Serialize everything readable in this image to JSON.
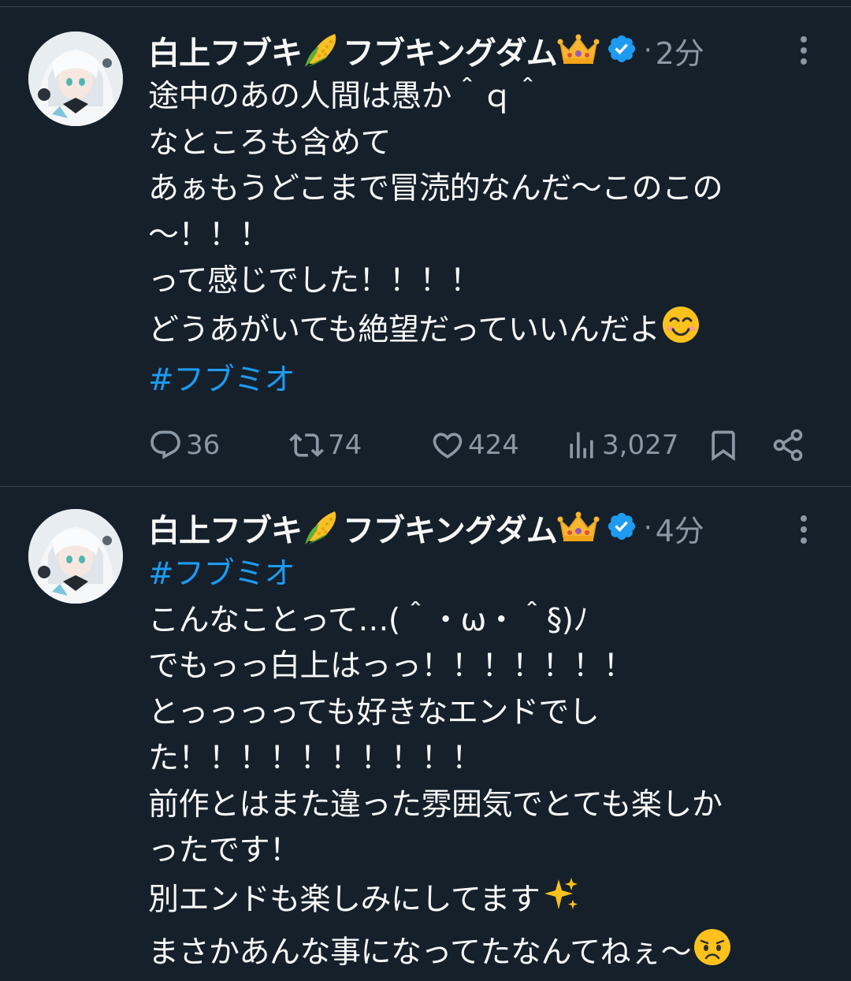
{
  "tweets": [
    {
      "author": {
        "name_part1": "白上フブキ",
        "name_part2": "フブキングダム",
        "emoji_1": "corn-emoji",
        "emoji_2": "crown-emoji",
        "verified": true
      },
      "separator": "·",
      "time": "2分",
      "lines": [
        "途中のあの人間は愚か＾ｑ＾",
        "なところも含めて",
        "あぁもうどこまで冒涜的なんだ〜このこの",
        "〜！！！",
        "って感じでした！！！！",
        "どうあがいても絶望だっていいんだよ"
      ],
      "trailing_emoji": "smiling-face-emoji",
      "hashtag": "#フブミオ",
      "stats": {
        "replies": "36",
        "reposts": "74",
        "likes": "424",
        "views": "3,027"
      }
    },
    {
      "author": {
        "name_part1": "白上フブキ",
        "name_part2": "フブキングダム",
        "emoji_1": "corn-emoji",
        "emoji_2": "crown-emoji",
        "verified": true
      },
      "separator": "·",
      "time": "4分",
      "hashtag": "#フブミオ",
      "lines": [
        "こんなことって…(＾・ω・＾§)ﾉ",
        "でもっっ白上はっっ！！！！！！！",
        "とっっっっても好きなエンドでし",
        "た！！！！！！！！！！",
        "前作とはまた違った雰囲気でとても楽しか",
        "ったです！",
        "別エンドも楽しみにしてます",
        "まさかあんな事になってたなんてねぇ〜"
      ],
      "sparkles_emoji": "sparkles-emoji",
      "worried_emoji": "worried-face-emoji"
    }
  ],
  "colors": {
    "background": "#15202b",
    "text": "#f7f9f9",
    "secondary": "#8b98a5",
    "accent": "#1d9bf0",
    "divider": "#38444d"
  }
}
